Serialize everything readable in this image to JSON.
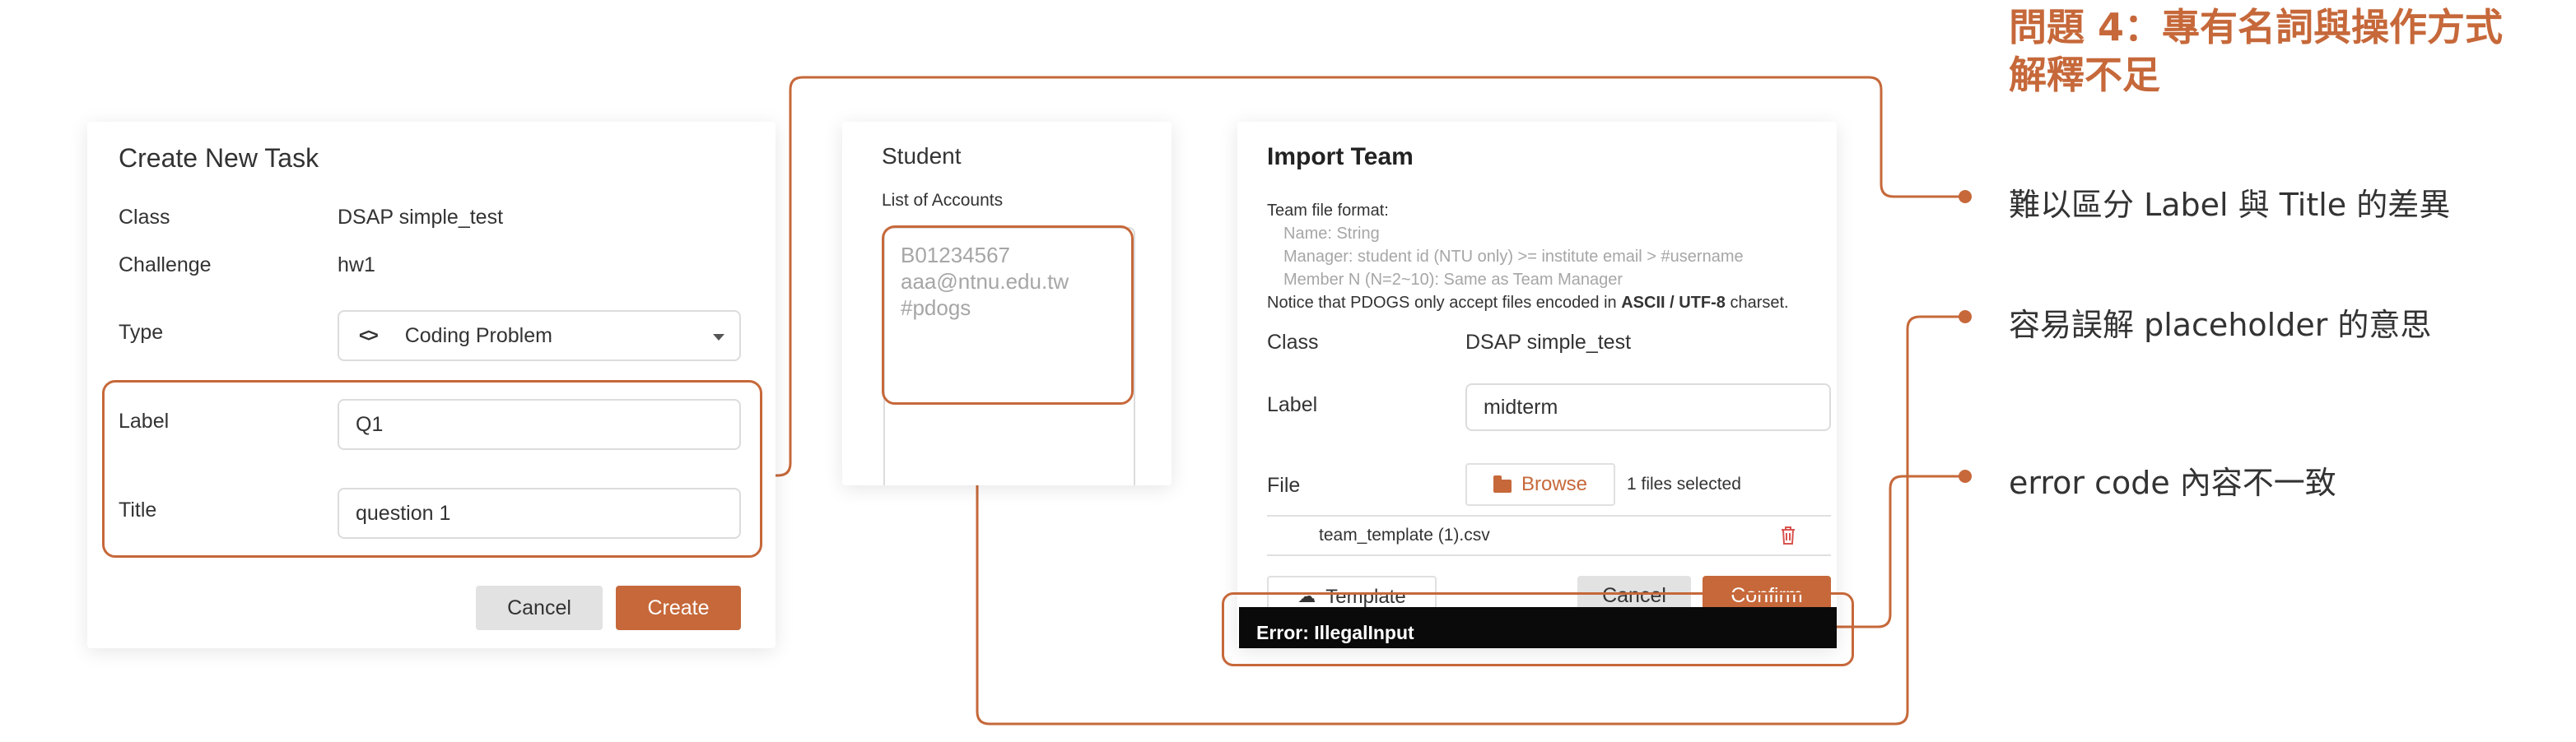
{
  "heading": {
    "line1": "問題 4：專有名詞與操作方式",
    "line2": "解釋不足"
  },
  "annotations": [
    "難以區分 Label 與 Title 的差異",
    "容易誤解 placeholder  的意思",
    "error code 內容不一致"
  ],
  "create_task": {
    "title": "Create New Task",
    "class_label": "Class",
    "class_value": "DSAP simple_test",
    "challenge_label": "Challenge",
    "challenge_value": "hw1",
    "type_label": "Type",
    "type_value": "Coding Problem",
    "label_label": "Label",
    "label_value": "Q1",
    "title_label": "Title",
    "title_value": "question 1",
    "cancel": "Cancel",
    "create": "Create"
  },
  "student": {
    "title": "Student",
    "accounts_label": "List of Accounts",
    "placeholder_lines": [
      "B01234567",
      "aaa@ntnu.edu.tw",
      "#pdogs"
    ]
  },
  "import_team": {
    "title": "Import Team",
    "format_title": "Team file format:",
    "format_lines": [
      "Name: String",
      "Manager: student id (NTU only) >= institute email > #username",
      "Member N (N=2~10): Same as Team Manager"
    ],
    "notice_pre": "Notice that PDOGS only accept files encoded in ",
    "notice_bold": "ASCII / UTF-8",
    "notice_post": " charset.",
    "class_label": "Class",
    "class_value": "DSAP simple_test",
    "label_label": "Label",
    "label_value": "midterm",
    "file_label": "File",
    "browse": "Browse",
    "files_selected": "1 files selected",
    "file_name": "team_template (1).csv",
    "template": "Template",
    "cancel": "Cancel",
    "confirm": "Confirm",
    "error": "Error: IllegalInput"
  },
  "colors": {
    "accent": "#c6683a",
    "error_bg": "#0a0a0a"
  }
}
